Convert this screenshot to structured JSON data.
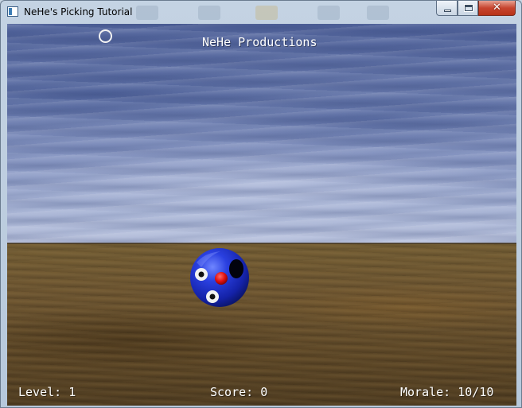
{
  "window": {
    "title": "NeHe's Picking Tutorial",
    "controls": {
      "minimize_icon": "minimize-icon",
      "maximize_icon": "maximize-icon",
      "close_glyph": "✕"
    }
  },
  "scene": {
    "banner": "NeHe Productions",
    "sky_color": "#6677aa",
    "ground_color": "#6a5330",
    "target": {
      "type": "blueface",
      "body_color": "#1f33d6",
      "nose_color": "#e01010"
    }
  },
  "hud": {
    "level_label": "Level:",
    "level_value": "1",
    "score_label": "Score:",
    "score_value": "0",
    "morale_label": "Morale:",
    "morale_value": "10/10"
  }
}
